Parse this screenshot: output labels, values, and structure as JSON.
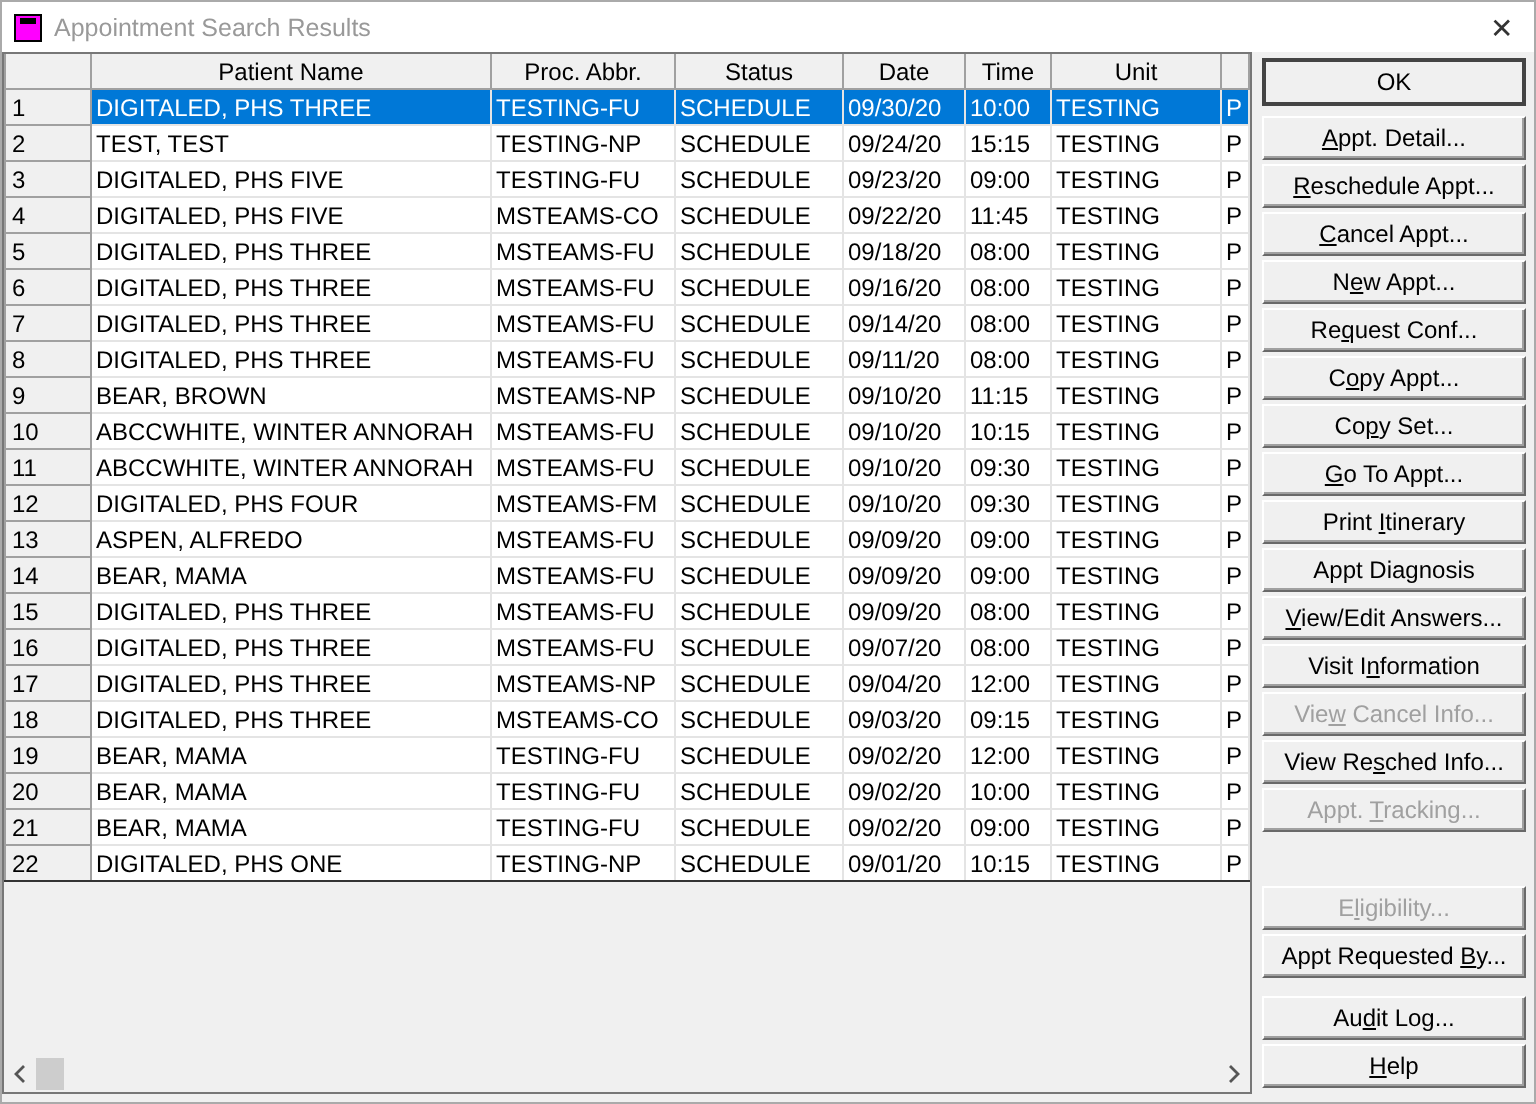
{
  "window": {
    "title": "Appointment Search Results",
    "close": "✕"
  },
  "table": {
    "columns": [
      "Patient Name",
      "Proc. Abbr.",
      "Status",
      "Date",
      "Time",
      "Unit"
    ],
    "rows": [
      {
        "num": "1",
        "cells": [
          "DIGITALED, PHS THREE",
          "TESTING-FU",
          "SCHEDULE",
          "09/30/20",
          "10:00",
          "TESTING",
          "P"
        ],
        "selected": true
      },
      {
        "num": "2",
        "cells": [
          "TEST, TEST",
          "TESTING-NP",
          "SCHEDULE",
          "09/24/20",
          "15:15",
          "TESTING",
          "P"
        ],
        "selected": false
      },
      {
        "num": "3",
        "cells": [
          "DIGITALED, PHS FIVE",
          "TESTING-FU",
          "SCHEDULE",
          "09/23/20",
          "09:00",
          "TESTING",
          "P"
        ],
        "selected": false
      },
      {
        "num": "4",
        "cells": [
          "DIGITALED, PHS FIVE",
          "MSTEAMS-CO",
          "SCHEDULE",
          "09/22/20",
          "11:45",
          "TESTING",
          "P"
        ],
        "selected": false
      },
      {
        "num": "5",
        "cells": [
          "DIGITALED, PHS THREE",
          "MSTEAMS-FU",
          "SCHEDULE",
          "09/18/20",
          "08:00",
          "TESTING",
          "P"
        ],
        "selected": false
      },
      {
        "num": "6",
        "cells": [
          "DIGITALED, PHS THREE",
          "MSTEAMS-FU",
          "SCHEDULE",
          "09/16/20",
          "08:00",
          "TESTING",
          "P"
        ],
        "selected": false
      },
      {
        "num": "7",
        "cells": [
          "DIGITALED, PHS THREE",
          "MSTEAMS-FU",
          "SCHEDULE",
          "09/14/20",
          "08:00",
          "TESTING",
          "P"
        ],
        "selected": false
      },
      {
        "num": "8",
        "cells": [
          "DIGITALED, PHS THREE",
          "MSTEAMS-FU",
          "SCHEDULE",
          "09/11/20",
          "08:00",
          "TESTING",
          "P"
        ],
        "selected": false
      },
      {
        "num": "9",
        "cells": [
          "BEAR, BROWN",
          "MSTEAMS-NP",
          "SCHEDULE",
          "09/10/20",
          "11:15",
          "TESTING",
          "P"
        ],
        "selected": false
      },
      {
        "num": "10",
        "cells": [
          "ABCCWHITE, WINTER ANNORAH",
          "MSTEAMS-FU",
          "SCHEDULE",
          "09/10/20",
          "10:15",
          "TESTING",
          "P"
        ],
        "selected": false
      },
      {
        "num": "11",
        "cells": [
          "ABCCWHITE, WINTER ANNORAH",
          "MSTEAMS-FU",
          "SCHEDULE",
          "09/10/20",
          "09:30",
          "TESTING",
          "P"
        ],
        "selected": false
      },
      {
        "num": "12",
        "cells": [
          "DIGITALED, PHS FOUR",
          "MSTEAMS-FM",
          "SCHEDULE",
          "09/10/20",
          "09:30",
          "TESTING",
          "P"
        ],
        "selected": false
      },
      {
        "num": "13",
        "cells": [
          "ASPEN, ALFREDO",
          "MSTEAMS-FU",
          "SCHEDULE",
          "09/09/20",
          "09:00",
          "TESTING",
          "P"
        ],
        "selected": false
      },
      {
        "num": "14",
        "cells": [
          "BEAR, MAMA",
          "MSTEAMS-FU",
          "SCHEDULE",
          "09/09/20",
          "09:00",
          "TESTING",
          "P"
        ],
        "selected": false
      },
      {
        "num": "15",
        "cells": [
          "DIGITALED, PHS THREE",
          "MSTEAMS-FU",
          "SCHEDULE",
          "09/09/20",
          "08:00",
          "TESTING",
          "P"
        ],
        "selected": false
      },
      {
        "num": "16",
        "cells": [
          "DIGITALED, PHS THREE",
          "MSTEAMS-FU",
          "SCHEDULE",
          "09/07/20",
          "08:00",
          "TESTING",
          "P"
        ],
        "selected": false
      },
      {
        "num": "17",
        "cells": [
          "DIGITALED, PHS THREE",
          "MSTEAMS-NP",
          "SCHEDULE",
          "09/04/20",
          "12:00",
          "TESTING",
          "P"
        ],
        "selected": false
      },
      {
        "num": "18",
        "cells": [
          "DIGITALED, PHS THREE",
          "MSTEAMS-CO",
          "SCHEDULE",
          "09/03/20",
          "09:15",
          "TESTING",
          "P"
        ],
        "selected": false
      },
      {
        "num": "19",
        "cells": [
          "BEAR, MAMA",
          "TESTING-FU",
          "SCHEDULE",
          "09/02/20",
          "12:00",
          "TESTING",
          "P"
        ],
        "selected": false
      },
      {
        "num": "20",
        "cells": [
          "BEAR, MAMA",
          "TESTING-FU",
          "SCHEDULE",
          "09/02/20",
          "10:00",
          "TESTING",
          "P"
        ],
        "selected": false
      },
      {
        "num": "21",
        "cells": [
          "BEAR, MAMA",
          "TESTING-FU",
          "SCHEDULE",
          "09/02/20",
          "09:00",
          "TESTING",
          "P"
        ],
        "selected": false
      },
      {
        "num": "22",
        "cells": [
          "DIGITALED, PHS ONE",
          "TESTING-NP",
          "SCHEDULE",
          "09/01/20",
          "10:15",
          "TESTING",
          "P"
        ],
        "selected": false
      }
    ]
  },
  "buttons": [
    {
      "pre": "OK",
      "default": true,
      "disabled": false
    },
    {
      "key": "A",
      "post": "ppt. Detail...",
      "disabled": false
    },
    {
      "key": "R",
      "post": "eschedule Appt...",
      "disabled": false
    },
    {
      "key": "C",
      "post": "ancel Appt...",
      "disabled": false
    },
    {
      "pre": "N",
      "key": "e",
      "post": "w Appt...",
      "disabled": false
    },
    {
      "pre": "Re",
      "key": "q",
      "post": "uest Conf...",
      "disabled": false
    },
    {
      "pre": "C",
      "key": "o",
      "post": "py Appt...",
      "disabled": false
    },
    {
      "pre": "Co",
      "key": "p",
      "post": "y Set...",
      "disabled": false
    },
    {
      "key": "G",
      "post": "o To Appt...",
      "disabled": false
    },
    {
      "pre": "Print ",
      "key": "I",
      "post": "tinerary",
      "disabled": false
    },
    {
      "pre": "Appt Diagnosis",
      "disabled": false
    },
    {
      "key": "V",
      "post": "iew/Edit Answers...",
      "disabled": false
    },
    {
      "pre": "Visit I",
      "key": "n",
      "post": "formation",
      "disabled": false
    },
    {
      "pre": "Vie",
      "key": "w",
      "post": " Cancel Info...",
      "disabled": true
    },
    {
      "pre": "View Re",
      "key": "s",
      "post": "ched Info...",
      "disabled": false
    },
    {
      "pre": "Appt. ",
      "key": "T",
      "post": "racking...",
      "disabled": true,
      "gap_after": true
    },
    {
      "pre": "E",
      "key": "l",
      "post": "igibility...",
      "disabled": true
    },
    {
      "pre": "Appt Requested ",
      "key": "B",
      "post": "y...",
      "disabled": false,
      "gap_after": true
    },
    {
      "pre": "Au",
      "key": "d",
      "post": "it Log...",
      "disabled": false
    },
    {
      "key": "H",
      "post": "elp",
      "disabled": false
    }
  ]
}
